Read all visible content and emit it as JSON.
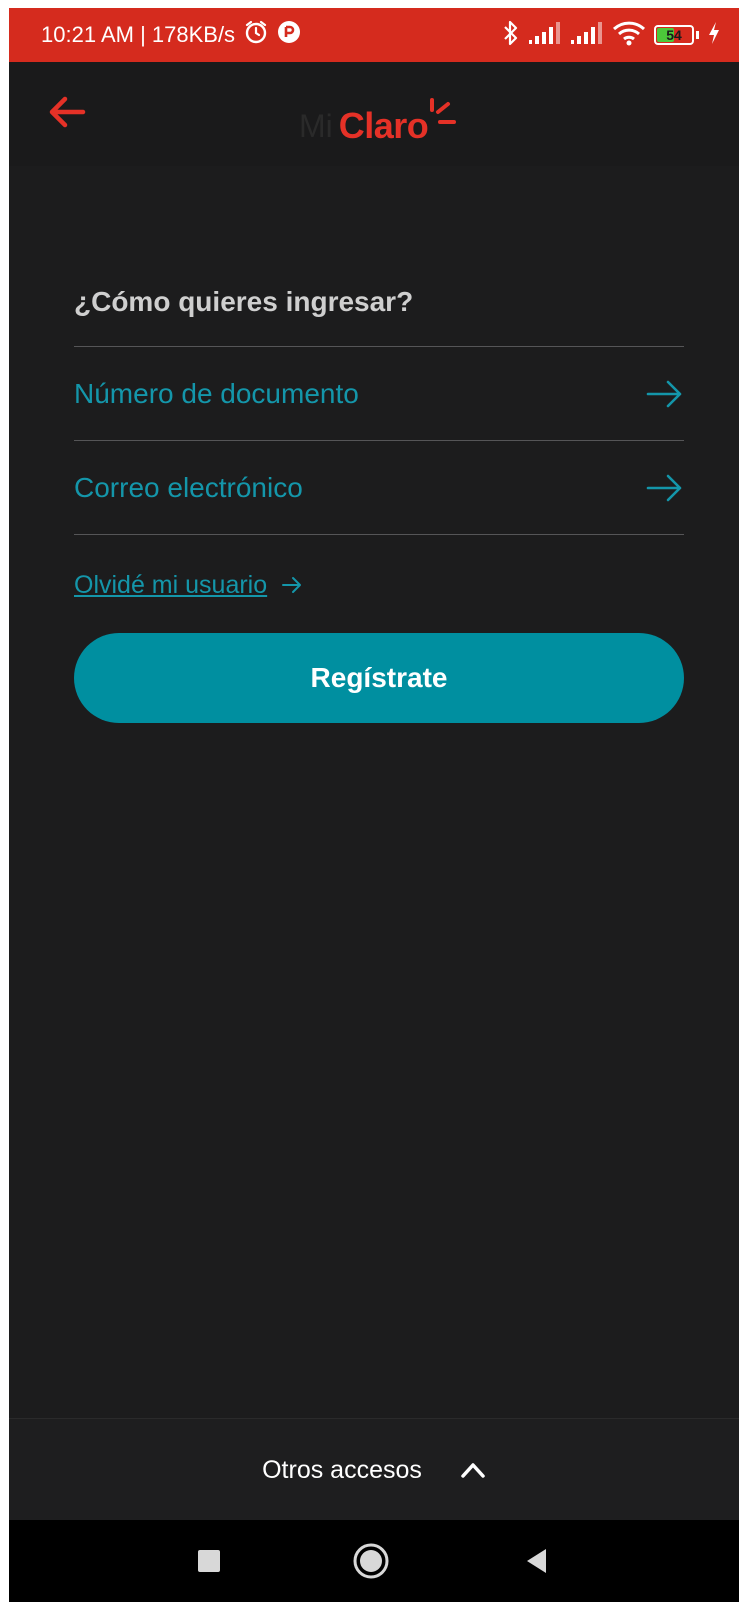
{
  "status_bar": {
    "time_and_speed": "10:21 AM | 178KB/s",
    "battery_level": "54",
    "battery_fraction": 0.54,
    "icons": [
      "alarm-icon",
      "app-notification-icon",
      "bluetooth-icon",
      "signal-icon",
      "signal-icon",
      "wifi-icon",
      "battery-icon",
      "charging-icon"
    ]
  },
  "header": {
    "logo_prefix": "Mi",
    "logo_text": "Claro",
    "back_icon": "arrow-left-icon"
  },
  "login": {
    "title": "¿Cómo quieres ingresar?",
    "options": [
      {
        "label": "Número de documento",
        "icon": "arrow-right-icon"
      },
      {
        "label": "Correo electrónico",
        "icon": "arrow-right-icon"
      }
    ],
    "forgot_user_label": "Olvidé mi usuario",
    "register_label": "Regístrate"
  },
  "footer": {
    "other_access_label": "Otros accesos",
    "toggle_icon": "chevron-up-icon"
  },
  "nav": {
    "icons": [
      "recent-apps-icon",
      "home-icon",
      "back-triangle-icon"
    ]
  },
  "colors": {
    "brand_red": "#e53127",
    "status_bar_red": "#d52b1e",
    "accent_teal": "#1496aa",
    "button_teal": "#008fa0",
    "background": "#1c1c1d"
  }
}
